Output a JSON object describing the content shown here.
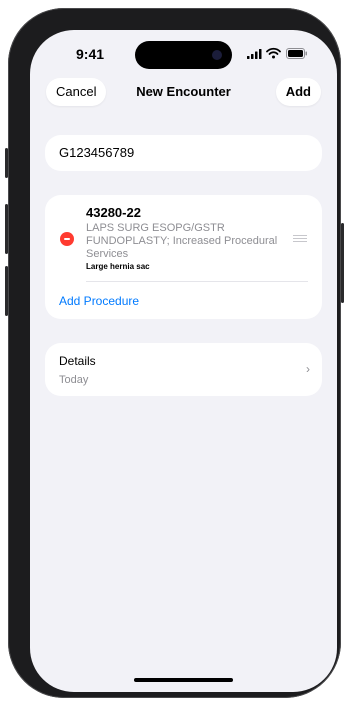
{
  "status": {
    "time": "9:41"
  },
  "nav": {
    "cancel_label": "Cancel",
    "title": "New Encounter",
    "add_label": "Add"
  },
  "patient": {
    "id": "G123456789"
  },
  "procedures": [
    {
      "code": "43280-22",
      "description": "LAPS SURG ESOPG/GSTR FUNDOPLASTY; Increased Procedural Services",
      "note": "Large hernia sac"
    }
  ],
  "add_procedure_label": "Add Procedure",
  "details": {
    "title": "Details",
    "value": "Today"
  },
  "colors": {
    "accent": "#007aff",
    "destructive": "#ff3b30",
    "background": "#f2f2f7"
  }
}
